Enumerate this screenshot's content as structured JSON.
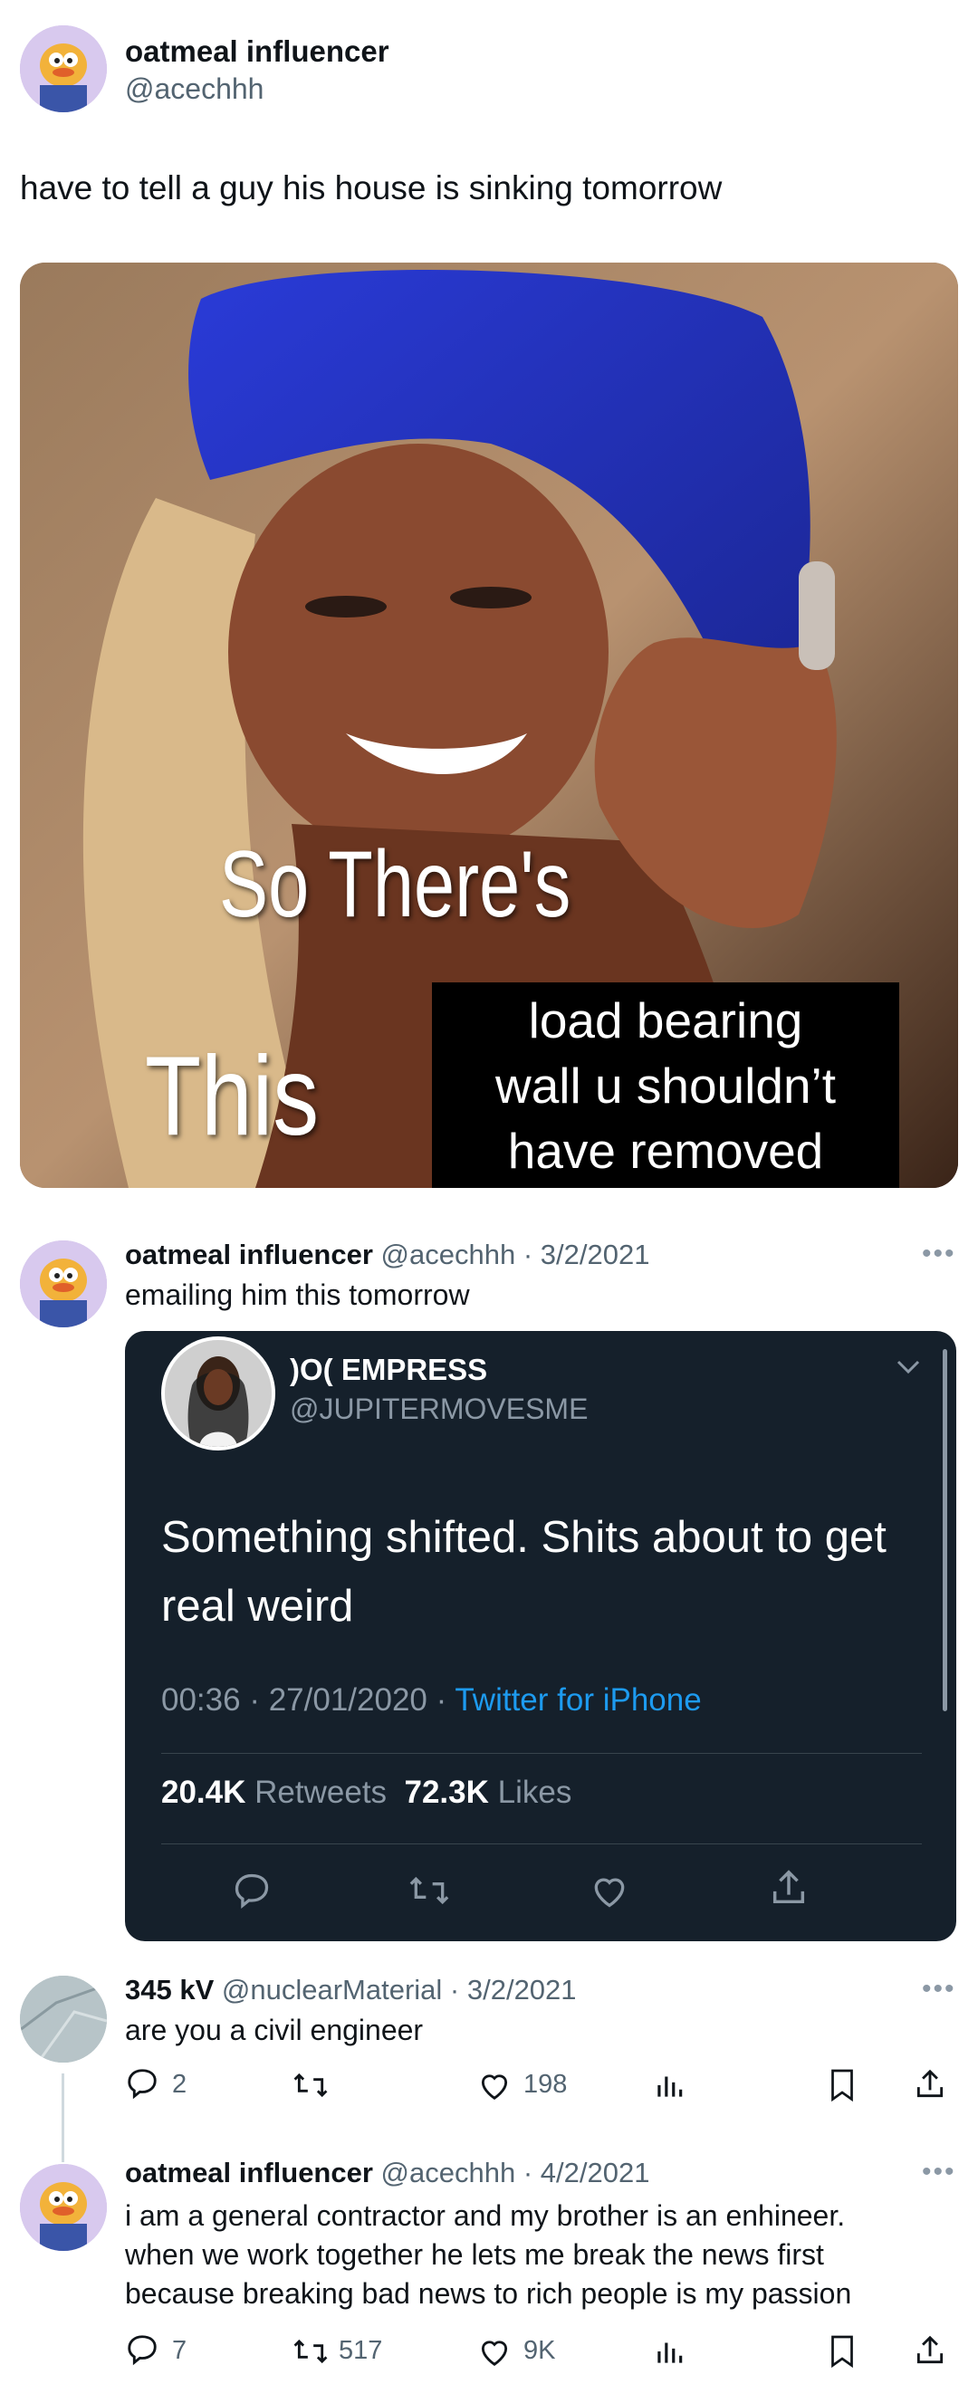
{
  "main_tweet": {
    "display_name": "oatmeal influencer",
    "handle": "@acechhh",
    "text": "have to tell a guy his house is sinking tomorrow",
    "meme": {
      "caption_top": "So There's",
      "caption_bottom": "This",
      "overlay_text": [
        "load bearing",
        "wall u shouldn’t",
        "have removed"
      ]
    }
  },
  "reply1": {
    "display_name": "oatmeal influencer",
    "handle": "@acechhh",
    "date": "3/2/2021",
    "text": "emailing him this tomorrow",
    "quoted": {
      "display_name": ")O( EMPRESS",
      "handle": "@JUPITERMOVESME",
      "text": "Something shifted. Shits about to get real weird",
      "time": "00:36",
      "date": "27/01/2020",
      "source": "Twitter for iPhone",
      "retweets_count": "20.4K",
      "retweets_label": "Retweets",
      "likes_count": "72.3K",
      "likes_label": "Likes"
    }
  },
  "reply2": {
    "display_name": "345 kV",
    "handle": "@nuclearMaterial",
    "date": "3/2/2021",
    "text": "are you a civil engineer",
    "replies": "2",
    "likes": "198"
  },
  "reply3": {
    "display_name": "oatmeal influencer",
    "handle": "@acechhh",
    "date": "4/2/2021",
    "text": "i am a general contractor and my brother is an enhineer. when we work together he lets me break the news first because breaking bad news to rich people is my passion",
    "replies": "7",
    "retweets": "517",
    "likes": "9K"
  },
  "colors": {
    "accent": "#1d9bf0",
    "text": "#0f1419",
    "muted": "#536471",
    "dark_card": "#15202b"
  }
}
